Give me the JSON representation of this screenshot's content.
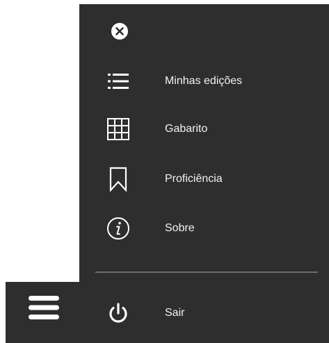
{
  "menu": {
    "close_icon": "close-icon",
    "items": [
      {
        "label": "Minhas edições",
        "icon": "list-icon"
      },
      {
        "label": "Gabarito",
        "icon": "grid-icon"
      },
      {
        "label": "Proficiência",
        "icon": "bookmark-icon"
      },
      {
        "label": "Sobre",
        "icon": "info-icon"
      }
    ],
    "logout": {
      "label": "Sair",
      "icon": "power-icon"
    },
    "toggle_icon": "hamburger-icon"
  },
  "colors": {
    "panel_bg": "#2e2e2e",
    "text": "#f2f2f2",
    "divider": "#6a6a6a",
    "icon": "#ffffff"
  }
}
